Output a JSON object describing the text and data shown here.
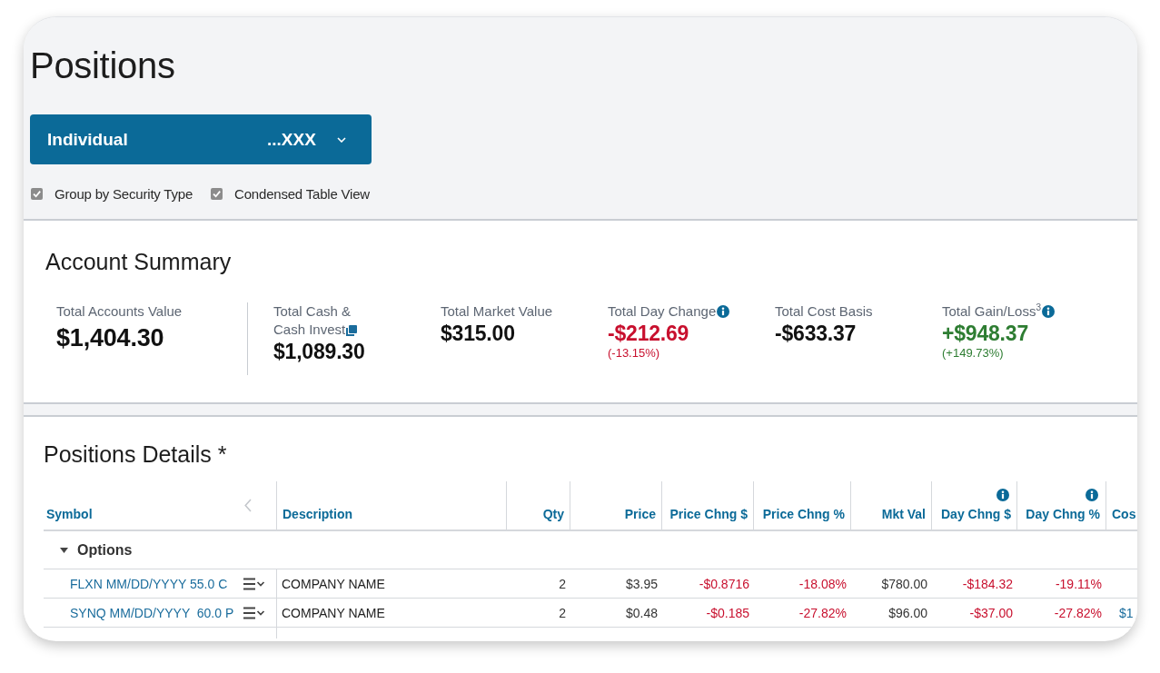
{
  "page": {
    "title": "Positions"
  },
  "account_selector": {
    "name": "Individual",
    "number": "...XXX",
    "expanded": false
  },
  "view_options": [
    {
      "label": "Group by Security Type",
      "checked": true
    },
    {
      "label": "Condensed Table View",
      "checked": true
    }
  ],
  "account_summary": {
    "title": "Account Summary",
    "metrics": [
      {
        "kind": "primary",
        "label": "Total Accounts Value",
        "value": "$1,404.30",
        "color": "#111111",
        "info": false
      },
      {
        "kind": "linked",
        "label": "Total Cash &\nCash Invest",
        "value": "$1,089.30",
        "color": "#111111",
        "info": false
      },
      {
        "kind": "plain",
        "label": "Total Market Value",
        "value": "$315.00",
        "color": "#111111",
        "info": false
      },
      {
        "kind": "plain",
        "label": "Total Day Change",
        "value": "-$212.69",
        "change": "(-13.15%)",
        "color": "#c8102e",
        "info": true
      },
      {
        "kind": "plain",
        "label": "Total Cost Basis",
        "value": "-$633.37",
        "color": "#111111",
        "info": false
      },
      {
        "kind": "plain",
        "label": "Total Gain/Loss$^{3}$",
        "value": "+$948.37",
        "change": "(+149.73%)",
        "color": "#2e7d32",
        "info": true
      }
    ]
  },
  "positions": {
    "title": "Positions Details *",
    "columns": [
      {
        "label": "Symbol",
        "kind": "text",
        "info": false
      },
      {
        "label": "Description",
        "kind": "text",
        "info": false
      },
      {
        "label": "Qty",
        "kind": "numeric",
        "info": false
      },
      {
        "label": "Price",
        "kind": "numeric",
        "info": false
      },
      {
        "label": "Price Chng $",
        "kind": "numeric",
        "info": false
      },
      {
        "label": "Price Chng %",
        "kind": "numeric",
        "info": false
      },
      {
        "label": "Mkt Val",
        "kind": "numeric",
        "info": false
      },
      {
        "label": "Day Chng $",
        "kind": "numeric",
        "info": true
      },
      {
        "label": "Day Chng %",
        "kind": "numeric",
        "info": true
      },
      {
        "label": "Cos",
        "kind": "text",
        "info": false
      }
    ],
    "groups": [
      {
        "label": "Options",
        "expanded": true,
        "rows": [
          {
            "cells": [
              {
                "kind": "symbol",
                "text": "FLXN MM/DD/YYYY 55.0 C"
              },
              {
                "kind": "text",
                "text": "COMPANY NAME"
              },
              {
                "kind": "number",
                "text": "2"
              },
              {
                "kind": "number",
                "text": "$3.95"
              },
              {
                "kind": "negative",
                "text": "-$0.8716"
              },
              {
                "kind": "negative",
                "text": "-18.08%"
              },
              {
                "kind": "number",
                "text": "$780.00"
              },
              {
                "kind": "negative",
                "text": "-$184.32"
              },
              {
                "kind": "negative",
                "text": "-19.11%"
              }
            ]
          },
          {
            "cells": [
              {
                "kind": "symbol",
                "text": "SYNQ MM/DD/YYYY  60.0 P"
              },
              {
                "kind": "text",
                "text": "COMPANY NAME"
              },
              {
                "kind": "number",
                "text": "2"
              },
              {
                "kind": "number",
                "text": "$0.48"
              },
              {
                "kind": "negative",
                "text": "-$0.185"
              },
              {
                "kind": "negative",
                "text": "-27.82%"
              },
              {
                "kind": "number",
                "text": "$96.00"
              },
              {
                "kind": "negative",
                "text": "-$37.00"
              },
              {
                "kind": "negative",
                "text": "-27.82%"
              },
              {
                "kind": "link",
                "text": "$1"
              }
            ]
          }
        ]
      }
    ]
  }
}
